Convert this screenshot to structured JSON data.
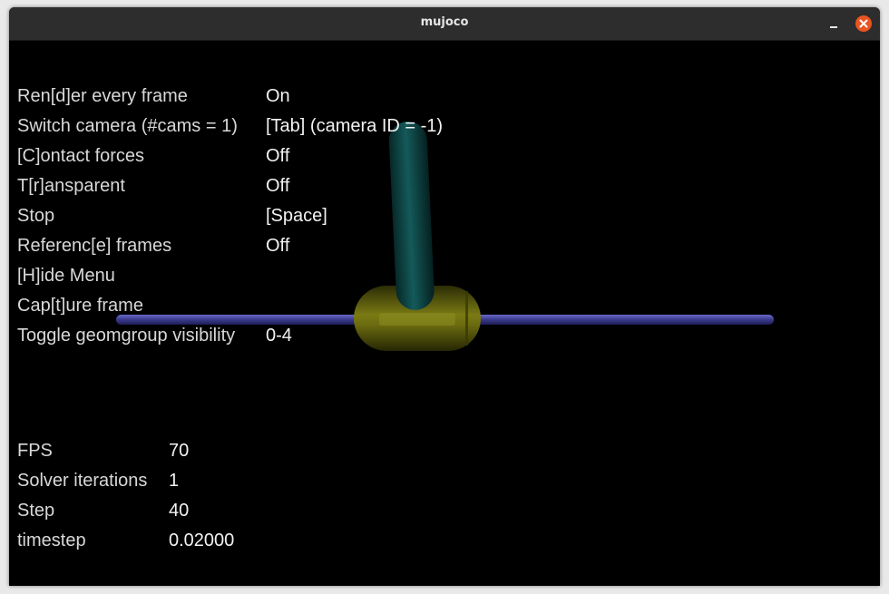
{
  "window": {
    "title": "mujoco"
  },
  "menu": {
    "items": [
      {
        "label": "Ren[d]er every frame",
        "value": "On"
      },
      {
        "label": "Switch camera (#cams = 1)",
        "value": "[Tab] (camera ID = -1)"
      },
      {
        "label": "[C]ontact forces",
        "value": "Off"
      },
      {
        "label": "T[r]ansparent",
        "value": "Off"
      },
      {
        "label": "Stop",
        "value": "[Space]"
      },
      {
        "label": "Referenc[e] frames",
        "value": "Off"
      },
      {
        "label": "[H]ide Menu",
        "value": ""
      },
      {
        "label": "Cap[t]ure frame",
        "value": ""
      },
      {
        "label": "Toggle geomgroup visibility",
        "value": "0-4"
      }
    ]
  },
  "stats": {
    "items": [
      {
        "label": "FPS",
        "value": "70"
      },
      {
        "label": "Solver iterations",
        "value": "1"
      },
      {
        "label": "Step",
        "value": "40"
      },
      {
        "label": "timestep",
        "value": "0.02000"
      }
    ]
  },
  "colors": {
    "rail": "#3a3a8c",
    "cart": "#6b6b10",
    "pole": "#0f4a4a",
    "close_button": "#e95420"
  }
}
